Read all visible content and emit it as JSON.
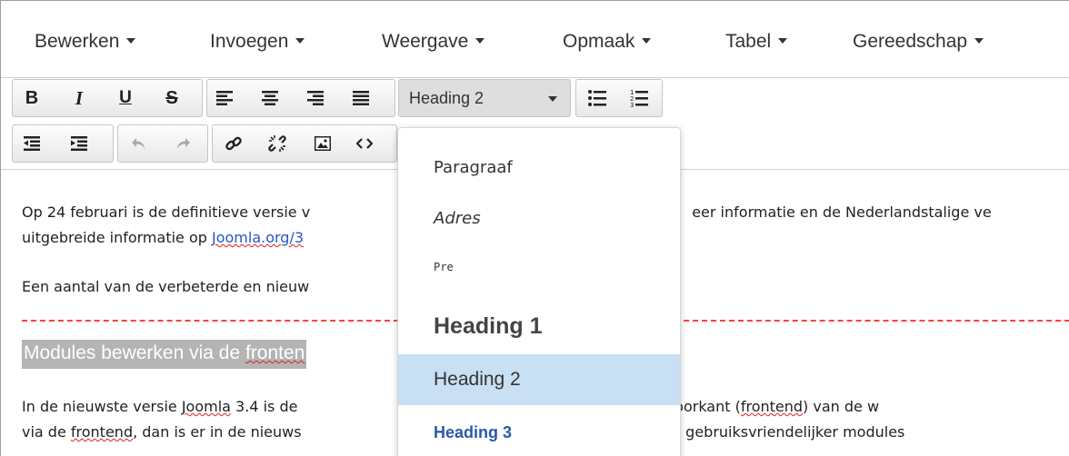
{
  "menubar": {
    "items": [
      {
        "label": "Bewerken"
      },
      {
        "label": "Invoegen"
      },
      {
        "label": "Weergave"
      },
      {
        "label": "Opmaak"
      },
      {
        "label": "Tabel"
      },
      {
        "label": "Gereedschap"
      }
    ]
  },
  "toolbar": {
    "bold": "B",
    "italic": "I",
    "underline": "U",
    "strikethrough": "S",
    "format_select": "Heading 2"
  },
  "dropdown": {
    "items": [
      {
        "label": "Paragraaf"
      },
      {
        "label": "Adres"
      },
      {
        "label": "Pre"
      },
      {
        "label": "Heading 1"
      },
      {
        "label": "Heading 2",
        "selected": true
      },
      {
        "label": "Heading 3"
      }
    ]
  },
  "content": {
    "p1_line1_a": "Op 24 februari is de definitieve versie v",
    "p1_line1_b": "eer informatie en de Nederlandstalige ve",
    "p1_line2_pre": "uitgebreide informatie op ",
    "p1_line2_link": "Joomla.org/3",
    "p2": "Een aantal van de verbeterde en nieuw",
    "heading_a": "Modules bewerken via de ",
    "heading_b": "fronten",
    "p3_line1_a": "In de nieuwste versie ",
    "p3_line1_b": "Joomla",
    "p3_line1_c": " 3.4 is de",
    "p3_line1_d": "ten via de voorkant (",
    "p3_line1_e": "frontend",
    "p3_line1_f": ") van de w",
    "p3_line2_a": "via de ",
    "p3_line2_b": "frontend",
    "p3_line2_c": ", dan is er in de nieuws",
    "p3_line2_d": "elijkheid om gebruiksvriendelijker modules"
  },
  "colors": {
    "dropdown_selected": "#c8dff4",
    "heading3_blue": "#2a5aa6",
    "link_blue": "#2a55c2",
    "spellcheck_red": "#e02020"
  }
}
